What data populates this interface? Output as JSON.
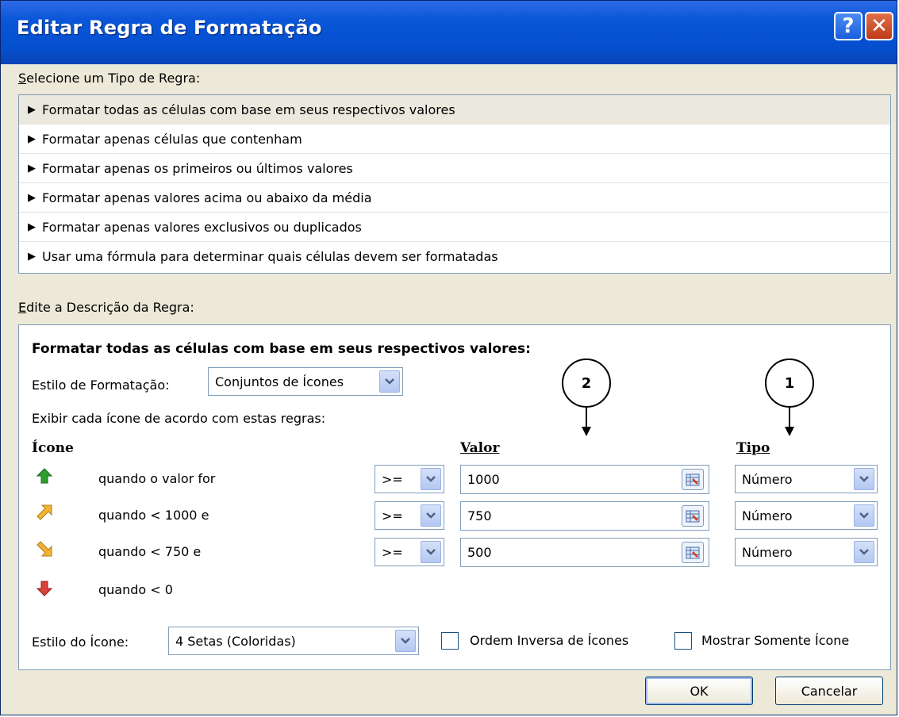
{
  "window": {
    "title": "Editar Regra de Formatação",
    "help_label": "?",
    "close_label": "✕"
  },
  "rule_type": {
    "label": "Selecione um Tipo de Regra:",
    "items": [
      "Formatar todas as células com base em seus respectivos valores",
      "Formatar apenas células que contenham",
      "Formatar apenas os primeiros ou últimos valores",
      "Formatar apenas valores acima ou abaixo da média",
      "Formatar apenas valores exclusivos ou duplicados",
      "Usar uma fórmula para determinar quais células devem ser formatadas"
    ],
    "selected_index": 0
  },
  "description": {
    "label": "Edite a Descrição da Regra:",
    "heading": "Formatar todas as células com base em seus respectivos valores:",
    "format_style_label": "Estilo de Formatação:",
    "format_style_value": "Conjuntos de Ícones",
    "rules_caption": "Exibir cada ícone de acordo com estas regras:",
    "col_icon": "Ícone",
    "col_value": "Valor",
    "col_type": "Tipo",
    "rows": [
      {
        "icon": "green-up-arrow-icon",
        "text": "quando o valor for",
        "operator": ">=",
        "value": "1000",
        "type": "Número"
      },
      {
        "icon": "yellow-up-right-arrow-icon",
        "text": "quando < 1000 e",
        "operator": ">=",
        "value": "750",
        "type": "Número"
      },
      {
        "icon": "yellow-down-right-arrow-icon",
        "text": "quando < 750 e",
        "operator": ">=",
        "value": "500",
        "type": "Número"
      },
      {
        "icon": "red-down-arrow-icon",
        "text": "quando < 0"
      }
    ],
    "icon_style_label": "Estilo do Ícone:",
    "icon_style_value": "4 Setas (Coloridas)",
    "reverse_label": "Ordem Inversa de Ícones",
    "show_icon_only_label": "Mostrar Somente Ícone"
  },
  "callouts": {
    "one": "1",
    "two": "2"
  },
  "buttons": {
    "ok": "OK",
    "cancel": "Cancelar"
  },
  "colors": {
    "title_bar": "#0450d0",
    "dialog_bg": "#ece9d8",
    "border": "#7f9db9",
    "selected_row": "#ebe8de"
  }
}
